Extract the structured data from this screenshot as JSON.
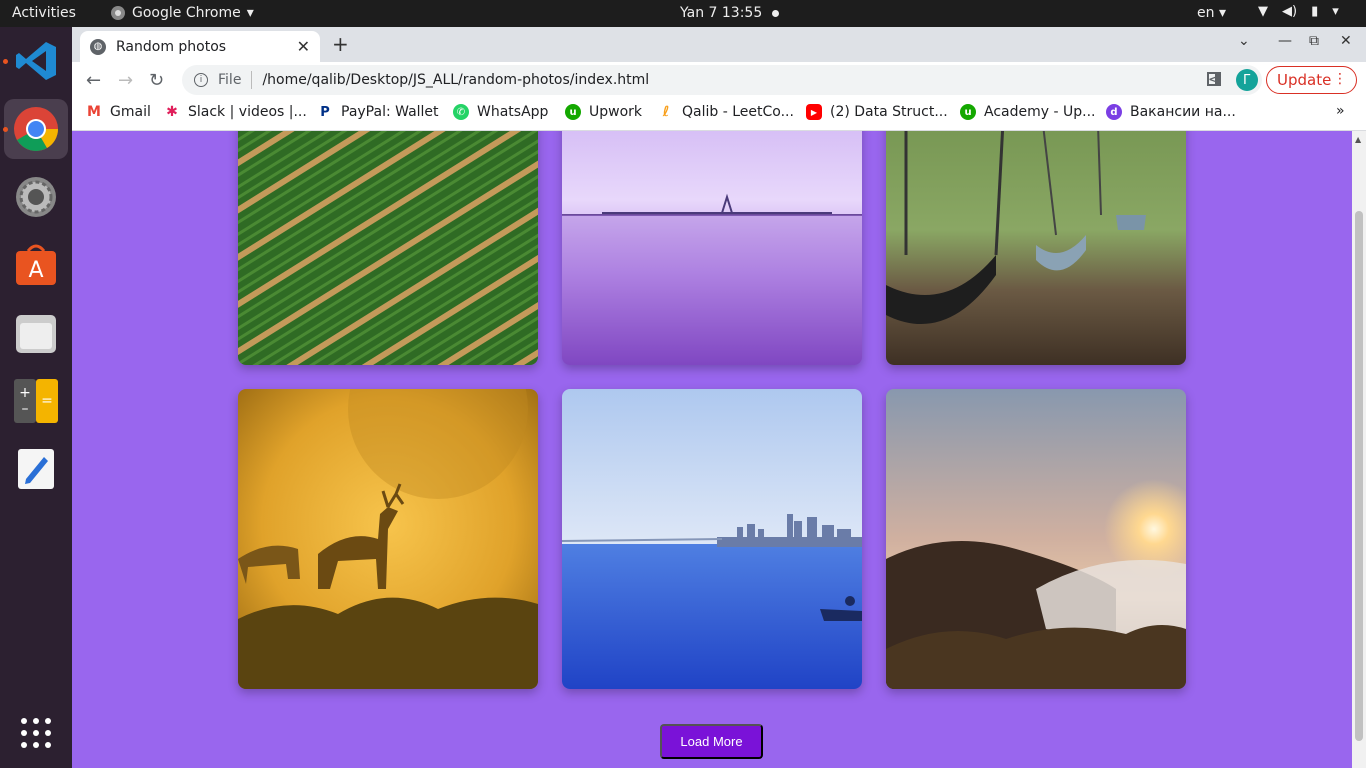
{
  "topbar": {
    "activities": "Activities",
    "app_name": "Google Chrome",
    "clock": "Yan 7  13:55",
    "lang": "en"
  },
  "dock": {
    "items": [
      "Visual Studio Code",
      "Google Chrome",
      "Settings",
      "Ubuntu Software",
      "Files",
      "Calculator",
      "Text Editor",
      "Show Applications"
    ]
  },
  "tab": {
    "title": "Random photos"
  },
  "omnibox": {
    "scheme": "File",
    "url": "/home/qalib/Desktop/JS_ALL/random-photos/index.html"
  },
  "profile": {
    "initial": "Г"
  },
  "update_label": "Update",
  "bookmarks": [
    {
      "label": "Gmail"
    },
    {
      "label": "Slack | videos |..."
    },
    {
      "label": "PayPal: Wallet"
    },
    {
      "label": "WhatsApp"
    },
    {
      "label": "Upwork"
    },
    {
      "label": "Qalib - LeetCo..."
    },
    {
      "label": "(2) Data Struct..."
    },
    {
      "label": "Academy - Up..."
    },
    {
      "label": "Вакансии на..."
    }
  ],
  "page": {
    "load_more": "Load More",
    "background": "#9966ee",
    "button_color": "#7a12d8"
  }
}
